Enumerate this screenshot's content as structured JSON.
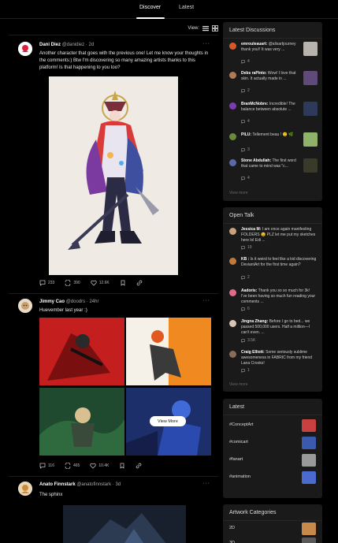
{
  "tabs": {
    "discover": "Discover",
    "latest": "Latest"
  },
  "view": {
    "label": "View:"
  },
  "posts": [
    {
      "name": "Dani Diez",
      "handle": "@danidiez",
      "time": "2d",
      "text": "Another character that goes with the previous one! Let me know your thoughts in the comments:) Btw I'm discovering so many amazing artists thanks to this platform! Is that happening to you too?",
      "comments": "233",
      "reposts": "390",
      "likes": "12.6K"
    },
    {
      "name": "Jimmy Cao",
      "handle": "@doodrs",
      "time": "24hr",
      "text": "Huevember last year :)",
      "comments": "116",
      "reposts": "465",
      "likes": "10.4K",
      "view_more": "View More"
    },
    {
      "name": "Anato Finnstark",
      "handle": "@anatofinnstark",
      "time": "3d",
      "text": "The sphinx"
    }
  ],
  "latest_discussions": {
    "title": "Latest Discussions",
    "items": [
      {
        "user": "emrouleauart:",
        "text": "@alisartjourney thank you!! It was very ...",
        "count": "4",
        "avatar_color": "#d9582b",
        "thumb_color": "#b9b3ad"
      },
      {
        "user": "Debs raPinto:",
        "text": "Wow! I love that skin. It actually made in ...",
        "count": "2",
        "avatar_color": "#b07a55",
        "thumb_color": "#5f4a7a"
      },
      {
        "user": "BranMcNobre:",
        "text": "Incredible! The balance between absolute ...",
        "count": "4",
        "avatar_color": "#7a3db0",
        "thumb_color": "#2d3a5a"
      },
      {
        "user": "PILU:",
        "text": "Tellement beau ! 😊 🌿",
        "count": "3",
        "avatar_color": "#6a8a3a",
        "thumb_color": "#8fb26a"
      },
      {
        "user": "Stone Abdullah:",
        "text": "The first word that came to mind was \"c...",
        "count": "4",
        "avatar_color": "#5a6aa8",
        "thumb_color": "#3a3a2a"
      }
    ],
    "view_more": "View more"
  },
  "open_talk": {
    "title": "Open Talk",
    "items": [
      {
        "user": "Jessica M:",
        "text": "I am once again manifesting FOLDERS 😉 PLZ let me put my sketches here lol Edi ...",
        "count": "19",
        "avatar_color": "#c9a27a"
      },
      {
        "user": "KB :",
        "text": "Is it weird to feel like a kid discovering DeviantArt for the first time again?",
        "count": "2",
        "avatar_color": "#c07a3a"
      },
      {
        "user": "Aadoris:",
        "text": "Thank you so so much for 3k! I've been having so much fun reading your comments ...",
        "count": "6",
        "avatar_color": "#e06a8a"
      },
      {
        "user": "Jingna Zhang:",
        "text": "Before I go to bed... we passed 500,000 users. Half a million—I can't even. ...",
        "count": "3.5K",
        "avatar_color": "#d8c4b4"
      },
      {
        "user": "Craig Elliott:",
        "text": "Some seriously sublime awesomeness in FABRIC from my friend Lana Crooks!",
        "count": "1",
        "avatar_color": "#8a6a5a"
      }
    ],
    "view_more": "View more"
  },
  "latest_tags": {
    "title": "Latest",
    "items": [
      {
        "tag": "#ConceptArt",
        "thumb_color": "#c94040"
      },
      {
        "tag": "#comicart",
        "thumb_color": "#3a5ab0"
      },
      {
        "tag": "#fanart",
        "thumb_color": "#9a9a9a"
      },
      {
        "tag": "#animation",
        "thumb_color": "#4a6ad0"
      }
    ]
  },
  "artwork_categories": {
    "title": "Artwork Categories",
    "items": [
      {
        "label": "2D",
        "thumb_color": "#c88a4a"
      },
      {
        "label": "3D",
        "thumb_color": "#5a5a5a"
      }
    ]
  }
}
